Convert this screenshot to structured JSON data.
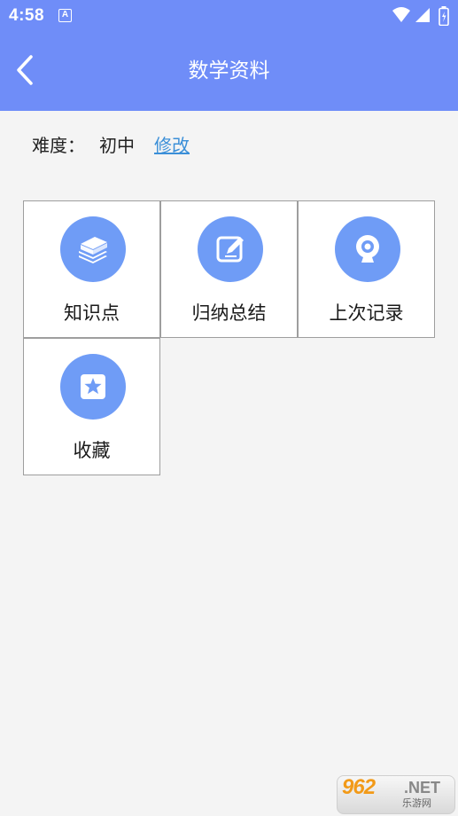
{
  "status_bar": {
    "time": "4:58",
    "notification_glyph": "A",
    "icons": [
      "wifi-icon",
      "signal-icon",
      "battery-icon"
    ]
  },
  "header": {
    "title": "数学资料",
    "back_icon": "chevron-left-icon",
    "background_color": "#6f8df8"
  },
  "difficulty": {
    "label": "难度：",
    "value": "初中",
    "edit_link": "修改",
    "link_color": "#3b8fd8"
  },
  "tiles": [
    {
      "label": "知识点",
      "icon": "books-icon"
    },
    {
      "label": "归纳总结",
      "icon": "edit-icon"
    },
    {
      "label": "上次记录",
      "icon": "webcam-icon"
    },
    {
      "label": "收藏",
      "icon": "star-icon"
    }
  ],
  "icon_color": "#6f9cf6",
  "watermark": {
    "brand": "962",
    "domain": ".NET",
    "subtitle": "乐游网"
  }
}
